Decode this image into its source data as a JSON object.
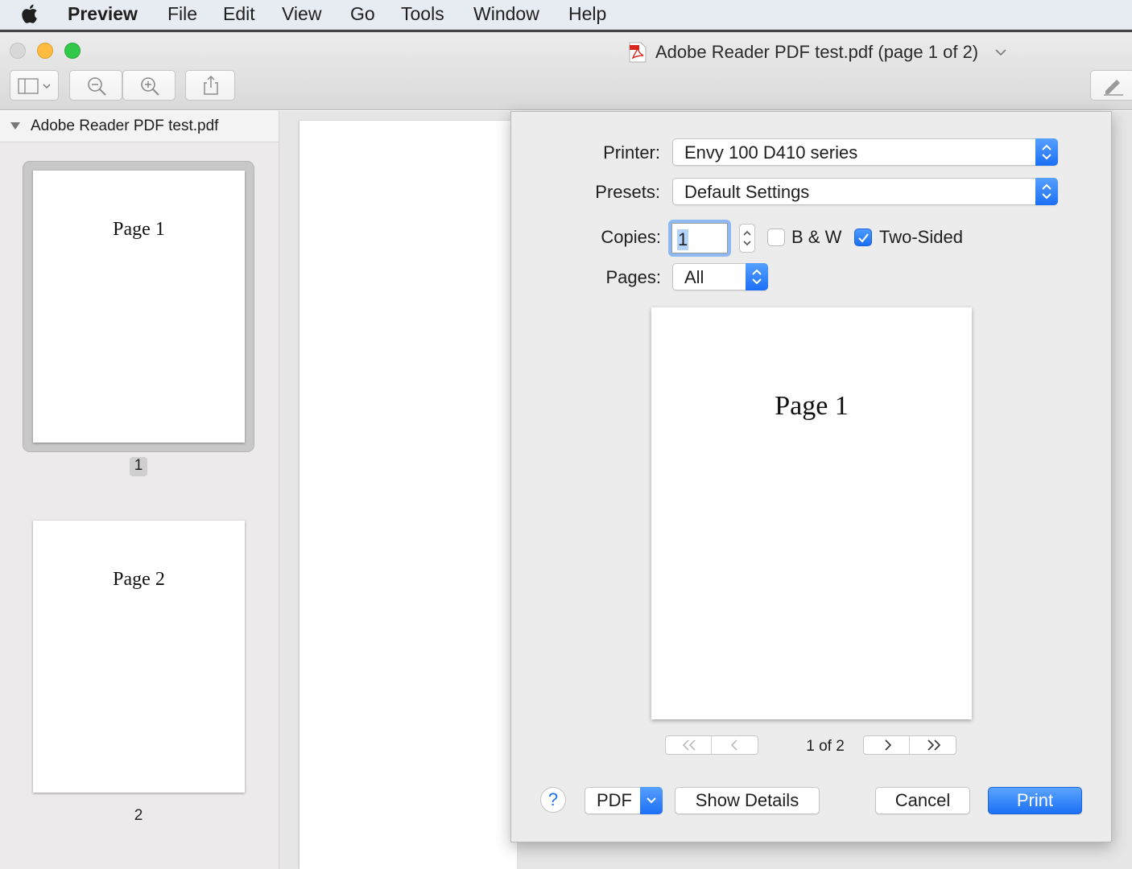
{
  "menubar": {
    "app": "Preview",
    "items": [
      "File",
      "Edit",
      "View",
      "Go",
      "Tools",
      "Window",
      "Help"
    ]
  },
  "window": {
    "title": "Adobe Reader PDF test.pdf (page 1 of 2)",
    "title_icon": "pdf-file-icon"
  },
  "toolbar": {
    "buttons": [
      "sidebar-toggle-icon",
      "zoom-out-icon",
      "zoom-in-icon",
      "share-icon",
      "markup-pen-icon"
    ]
  },
  "sidebar": {
    "document_name": "Adobe Reader PDF test.pdf",
    "thumbnails": [
      {
        "page_text": "Page 1",
        "number": "1",
        "selected": true
      },
      {
        "page_text": "Page 2",
        "number": "2",
        "selected": false
      }
    ]
  },
  "print": {
    "printer_label": "Printer:",
    "printer_value": "Envy 100 D410 series",
    "presets_label": "Presets:",
    "presets_value": "Default Settings",
    "copies_label": "Copies:",
    "copies_value": "1",
    "bw_label": "B & W",
    "bw_checked": false,
    "two_sided_label": "Two-Sided",
    "two_sided_checked": true,
    "pages_label": "Pages:",
    "pages_value": "All",
    "preview_text": "Page 1",
    "page_counter": "1 of 2",
    "help_label": "?",
    "pdf_label": "PDF",
    "show_details_label": "Show Details",
    "cancel_label": "Cancel",
    "print_label": "Print"
  },
  "colors": {
    "accent": "#1d70f5",
    "menubar": "#e7ecf3",
    "sheet": "#ececec"
  }
}
